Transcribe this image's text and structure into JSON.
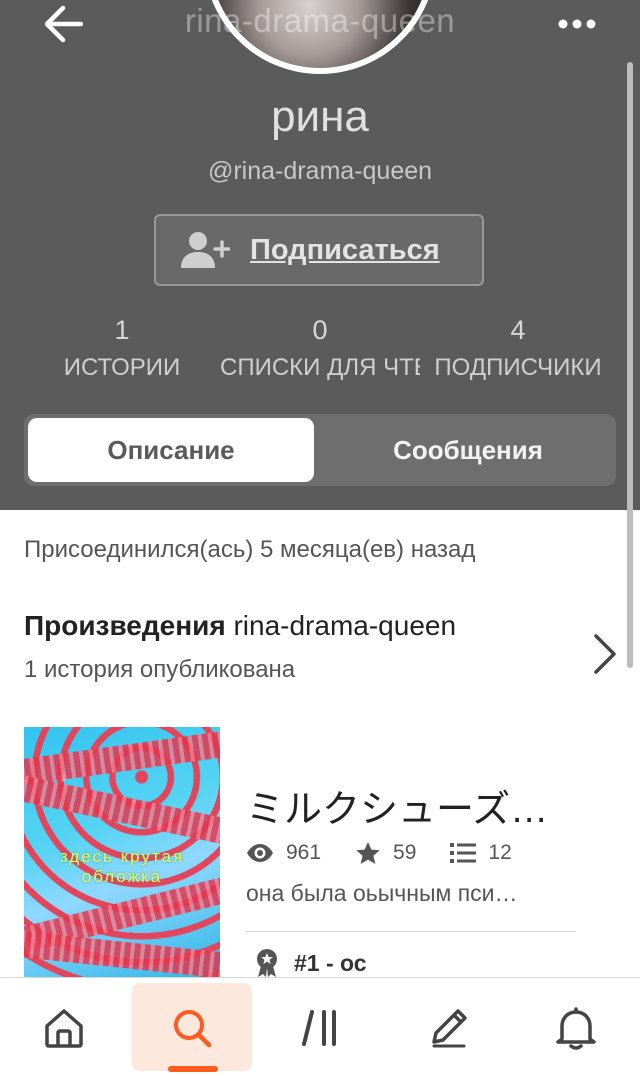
{
  "header": {
    "top_handle": "rina-drama-queen",
    "display_name": "рина",
    "username": "@rina-drama-queen",
    "follow_label": "Подписаться"
  },
  "stats": [
    {
      "value": "1",
      "label": "ИСТОРИИ"
    },
    {
      "value": "0",
      "label": "СПИСКИ ДЛЯ ЧТЕНИЯ"
    },
    {
      "value": "4",
      "label": "ПОДПИСЧИКИ"
    }
  ],
  "tabs": {
    "about": "Описание",
    "messages": "Сообщения"
  },
  "profile": {
    "joined": "Присоединился(ась) 5 месяца(ев) назад",
    "works_title_bold": "Произведения",
    "works_title_user": "rina-drama-queen",
    "works_subtitle": "1 история опубликована"
  },
  "story": {
    "title": "ミルクシューズ…",
    "reads": "961",
    "votes": "59",
    "parts": "12",
    "description": "она была оьычным пси…",
    "tag": "#1 - ос",
    "cover_text_1": "здесь крутая",
    "cover_text_2": "обложка"
  },
  "icons": {
    "back": "arrow-left-icon",
    "more": "more-horizontal-icon",
    "follow": "add-user-icon",
    "chevron": "chevron-right-icon",
    "reads": "eye-icon",
    "votes": "star-icon",
    "parts": "list-icon",
    "tag": "ribbon-badge-icon",
    "nav": [
      "home-icon",
      "search-icon",
      "library-icon",
      "write-icon",
      "bell-icon"
    ]
  },
  "colors": {
    "header_bg": "#5c5b5b",
    "accent": "#ff5a1f",
    "active_nav_bg": "#fde8dd"
  }
}
